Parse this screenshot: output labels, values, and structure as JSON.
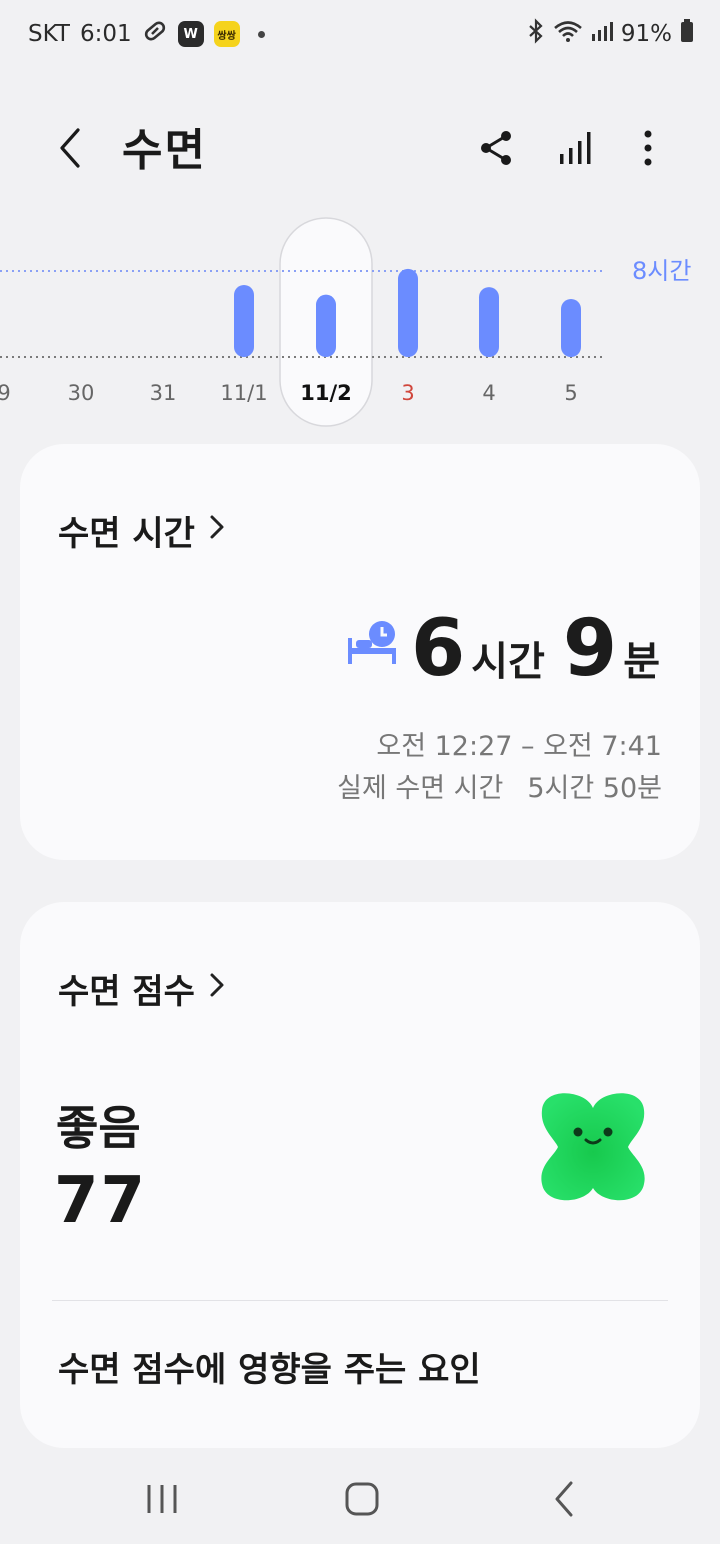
{
  "status_bar": {
    "carrier": "SKT",
    "time": "6:01",
    "badge_w": "W",
    "badge_yellow": "쌍쌍",
    "battery": "91%"
  },
  "app_bar": {
    "title": "수면"
  },
  "chart_data": {
    "type": "bar",
    "categories": [
      "9",
      "30",
      "31",
      "11/1",
      "11/2",
      "3",
      "4",
      "5"
    ],
    "values": [
      null,
      null,
      null,
      6.7,
      5.8,
      8.2,
      6.5,
      5.4
    ],
    "selected": "11/2",
    "reference_label": "8시간",
    "reference_value": 8,
    "highlight_category": "3",
    "highlight_color": "#d0463b",
    "bar_color": "#6b8cff"
  },
  "sleep_time_card": {
    "title": "수면 시간",
    "hours": "6",
    "hours_unit": "시간",
    "minutes": "9",
    "minutes_unit": "분",
    "time_range": "오전 12:27 – 오전 7:41",
    "actual_label": "실제 수면 시간",
    "actual_value": "5시간 50분"
  },
  "sleep_score_card": {
    "title": "수면 점수",
    "rating": "좋음",
    "score": "77",
    "factors_title": "수면 점수에 영향을 주는 요인"
  }
}
